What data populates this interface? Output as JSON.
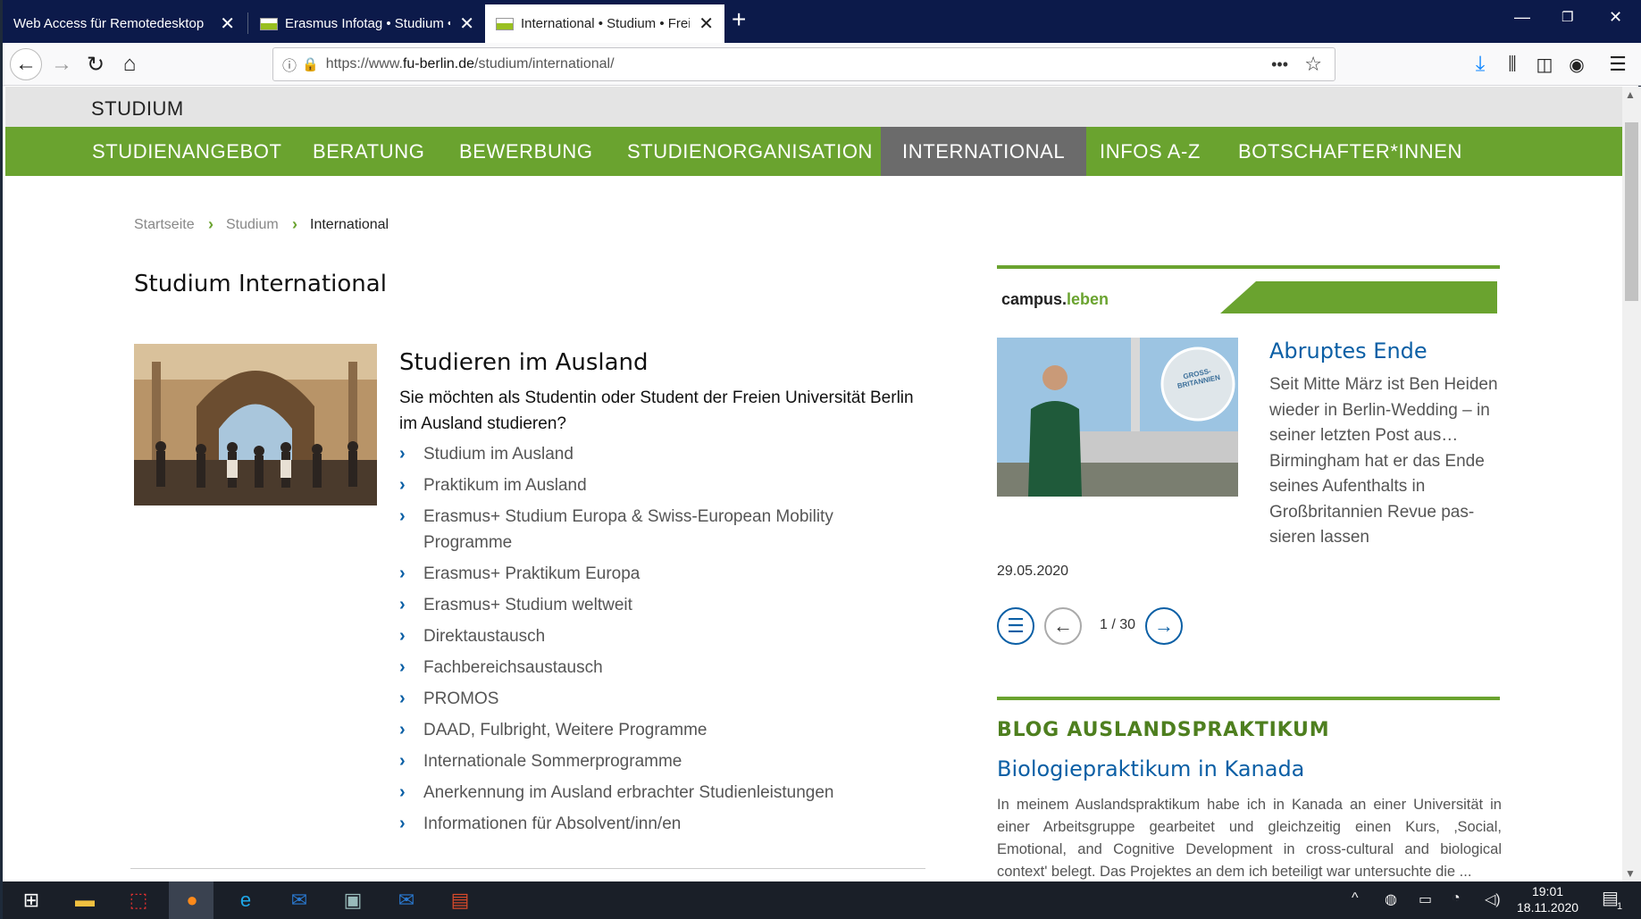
{
  "browser": {
    "tabs": [
      {
        "title": "Web Access für Remotedesktop"
      },
      {
        "title": "Erasmus Infotag • Studium • Freie Universität Berlin"
      },
      {
        "title": "International • Studium • Freie Universität Berlin"
      }
    ],
    "url_prefix": "https://www.",
    "url_host": "fu-berlin.de",
    "url_path": "/studium/international/"
  },
  "site": {
    "section_label": "STUDIUM",
    "nav": [
      {
        "label": "STUDIENANGEBOT",
        "active": false
      },
      {
        "label": "BERATUNG",
        "active": false
      },
      {
        "label": "BEWERBUNG",
        "active": false
      },
      {
        "label": "STUDIENORGANISATION",
        "active": false
      },
      {
        "label": "INTERNATIONAL",
        "active": true
      },
      {
        "label": "INFOS A-Z",
        "active": false
      },
      {
        "label": "BOTSCHAFTER*INNEN",
        "active": false
      }
    ],
    "breadcrumb": [
      "Startseite",
      "Studium",
      "International"
    ],
    "page_title": "Studium International"
  },
  "main": {
    "section_title": "Studieren im Ausland",
    "intro": "Sie möchten als Studentin oder Student der Freien Universität Berlin im Ausland studieren?",
    "links": [
      "Studium im Ausland",
      "Praktikum im Ausland",
      "Erasmus+ Studium Europa & Swiss-European Mobility Programme",
      "Erasmus+ Praktikum Europa",
      "Erasmus+ Studium weltweit",
      "Direktaustausch",
      "Fachbereichsaustausch",
      "PROMOS",
      "DAAD, Fulbright, Weitere Programme",
      "Internationale Sommerprogramme",
      "Anerkennung im Ausland erbrachter Studienleistungen",
      "Informationen für Absolvent/inn/en"
    ]
  },
  "sidebar": {
    "campus_logo_a": "campus.",
    "campus_logo_b": "leben",
    "news_title": "Abruptes Ende",
    "news_text": "Seit Mitte März ist Ben Heiden wieder in Berlin-Wedding – in seiner letzten Post aus… Birmingham hat er das Ende seines Aufenthalts in Großbritannien Revue pas­sieren lassen",
    "news_badge": "GROSS-BRITANNIEN",
    "news_date": "29.05.2020",
    "pager": "1 / 30",
    "blog_heading": "BLOG AUSLANDSPRAKTIKUM",
    "blog_title": "Biologiepraktikum in Kanada",
    "blog_text": "In meinem Auslandspraktikum habe ich in Kanada an einer Universität in einer Arbeitsgruppe gearbeitet und gleichzeitig einen Kurs, ‚Social, Emotional, and Cognitive Development in cross-cultural and biological context' belegt. Das Projektes an dem ich beteiligt war untersuchte die ..."
  },
  "taskbar": {
    "time": "19:01",
    "date": "18.11.2020",
    "notification_count": "1"
  },
  "colors": {
    "fu_green": "#6aa32f",
    "nav_active": "#6b6b6b",
    "link_blue": "#0b5fa5",
    "tab_strip": "#0c1a4a"
  }
}
